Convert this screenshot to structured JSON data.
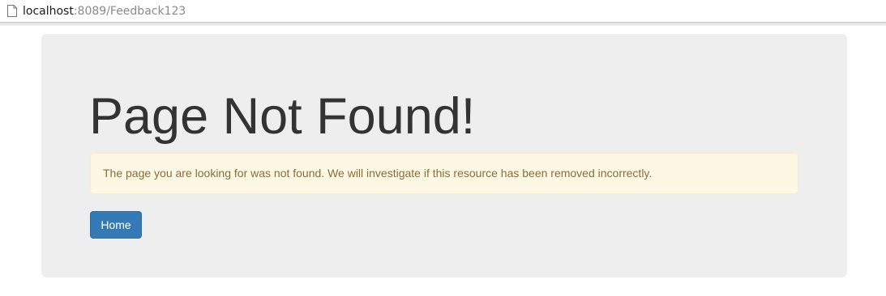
{
  "browser": {
    "url_host": "localhost",
    "url_rest": ":8089/Feedback123",
    "page_icon": "page-icon"
  },
  "jumbotron": {
    "title": "Page Not Found!",
    "alert_text": "The page you are looking for was not found. We will investigate if this resource has been removed incorrectly.",
    "home_button_label": "Home"
  },
  "colors": {
    "jumbotron_bg": "#eeeeee",
    "title_text": "#333333",
    "alert_bg": "#fcf8e3",
    "alert_border": "#faebcc",
    "alert_text": "#8a6d3b",
    "button_bg": "#337ab7",
    "button_text": "#ffffff"
  }
}
